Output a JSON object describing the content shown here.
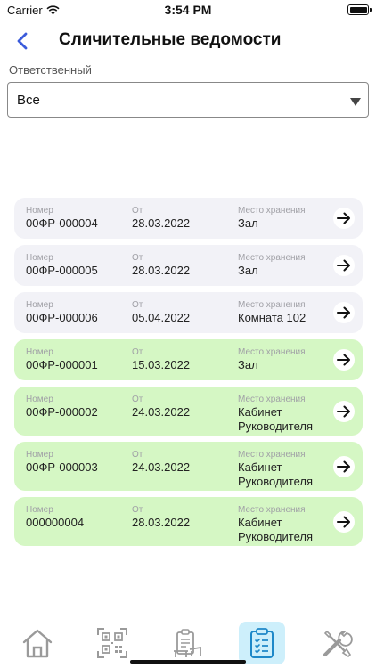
{
  "status": {
    "carrier": "Carrier",
    "time": "3:54 PM"
  },
  "header": {
    "title": "Сличительные ведомости"
  },
  "filter": {
    "label": "Ответственный",
    "value": "Все"
  },
  "labels": {
    "number": "Номер",
    "from": "От",
    "storage": "Место хранения"
  },
  "documents": [
    {
      "number": "00ФР-000004",
      "date": "28.03.2022",
      "storage_line1": "Зал",
      "storage_line2": "",
      "status": "default"
    },
    {
      "number": "00ФР-000005",
      "date": "28.03.2022",
      "storage_line1": "Зал",
      "storage_line2": "",
      "status": "default"
    },
    {
      "number": "00ФР-000006",
      "date": "05.04.2022",
      "storage_line1": "Комната 102",
      "storage_line2": "",
      "status": "default"
    },
    {
      "number": "00ФР-000001",
      "date": "15.03.2022",
      "storage_line1": "Зал",
      "storage_line2": "",
      "status": "green"
    },
    {
      "number": "00ФР-000002",
      "date": "24.03.2022",
      "storage_line1": "Кабинет",
      "storage_line2": "Руководителя",
      "status": "green"
    },
    {
      "number": "00ФР-000003",
      "date": "24.03.2022",
      "storage_line1": "Кабинет",
      "storage_line2": "Руководителя",
      "status": "green"
    },
    {
      "number": "000000004",
      "date": "28.03.2022",
      "storage_line1": "Кабинет",
      "storage_line2": "Руководителя",
      "status": "green"
    }
  ],
  "tabbar": {
    "tabs": [
      {
        "icon": "home-icon",
        "active": false
      },
      {
        "icon": "qr-code-icon",
        "active": false
      },
      {
        "icon": "inventory-desk-icon",
        "active": false
      },
      {
        "icon": "clipboard-list-icon",
        "active": true
      },
      {
        "icon": "tools-icon",
        "active": false
      }
    ]
  },
  "colors": {
    "accent": "#3b5bdb",
    "card_default": "#f2f2f7",
    "card_green": "#d5f7c4",
    "active_tab": "#cdeffb",
    "icon_gray": "#9a9a9a",
    "icon_active": "#1e88c8"
  }
}
